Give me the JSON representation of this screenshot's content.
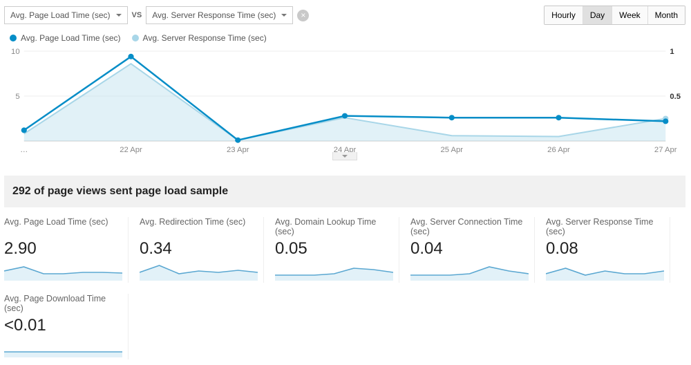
{
  "controls": {
    "primary_metric": "Avg. Page Load Time (sec)",
    "vs_label": "VS",
    "secondary_metric": "Avg. Server Response Time (sec)",
    "time_buttons": [
      "Hourly",
      "Day",
      "Week",
      "Month"
    ],
    "time_active_index": 1
  },
  "legend": {
    "primary": {
      "label": "Avg. Page Load Time (sec)",
      "color": "#058dc7"
    },
    "secondary": {
      "label": "Avg. Server Response Time (sec)",
      "color": "#a8d6e8"
    }
  },
  "chart_data": {
    "type": "line",
    "categories": [
      "…",
      "22 Apr",
      "23 Apr",
      "24 Apr",
      "25 Apr",
      "26 Apr",
      "27 Apr"
    ],
    "y_left_ticks": [
      5,
      10
    ],
    "y_right_ticks": [
      0.5,
      1
    ],
    "series": [
      {
        "name": "Avg. Page Load Time (sec)",
        "axis": "left",
        "color": "#058dc7",
        "values": [
          1.2,
          9.4,
          0.1,
          2.8,
          2.6,
          2.6,
          2.2
        ]
      },
      {
        "name": "Avg. Server Response Time (sec)",
        "axis": "right",
        "color": "#a8d6e8",
        "values": [
          0.08,
          0.86,
          0.01,
          0.26,
          0.06,
          0.05,
          0.25
        ],
        "fill": true
      }
    ],
    "left_ylim": [
      0,
      10
    ],
    "right_ylim": [
      0,
      1
    ]
  },
  "sample_text": "292 of page views sent page load sample",
  "cards": [
    {
      "title": "Avg. Page Load Time (sec)",
      "value": "2.90",
      "spark": [
        14,
        8,
        18,
        18,
        16,
        16,
        17
      ]
    },
    {
      "title": "Avg. Redirection Time (sec)",
      "value": "0.34",
      "spark": [
        16,
        6,
        18,
        14,
        16,
        13,
        16
      ]
    },
    {
      "title": "Avg. Domain Lookup Time (sec)",
      "value": "0.05",
      "spark": [
        20,
        20,
        20,
        18,
        10,
        12,
        16
      ]
    },
    {
      "title": "Avg. Server Connection Time (sec)",
      "value": "0.04",
      "spark": [
        20,
        20,
        20,
        18,
        8,
        14,
        18
      ]
    },
    {
      "title": "Avg. Server Response Time (sec)",
      "value": "0.08",
      "spark": [
        18,
        10,
        20,
        14,
        18,
        18,
        14
      ]
    },
    {
      "title": "Avg. Page Download Time (sec)",
      "value": "<0.01",
      "spark": [
        20,
        20,
        20,
        20,
        20,
        20,
        20
      ]
    }
  ]
}
